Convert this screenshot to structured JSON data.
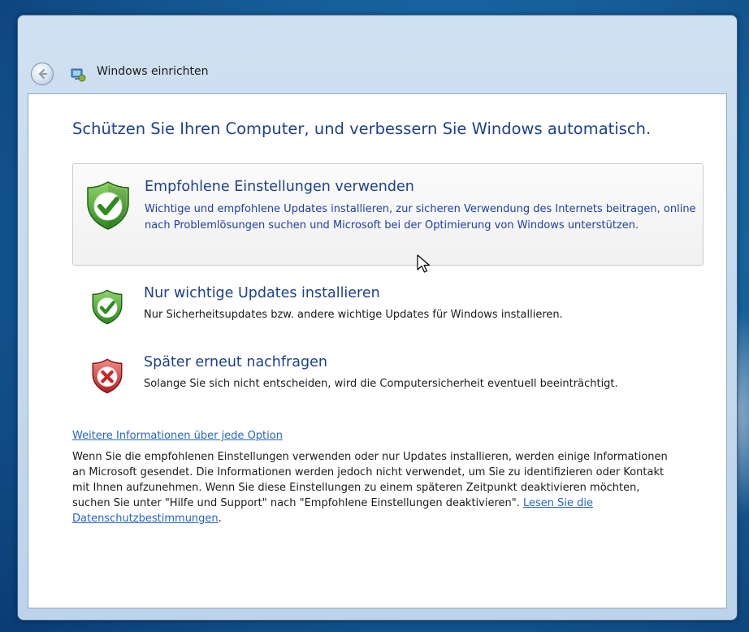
{
  "window": {
    "title": "Windows einrichten"
  },
  "heading": "Schützen Sie Ihren Computer, und verbessern Sie Windows automatisch.",
  "options": [
    {
      "title": "Empfohlene Einstellungen verwenden",
      "description": "Wichtige und empfohlene Updates installieren, zur sicheren Verwendung des Internets beitragen, online nach Problemlösungen suchen und Microsoft bei der Optimierung von Windows unterstützen.",
      "icon": "shield-check-icon",
      "selected": true
    },
    {
      "title": "Nur wichtige Updates installieren",
      "description": "Nur Sicherheitsupdates bzw. andere wichtige Updates für Windows installieren.",
      "icon": "shield-check-icon",
      "selected": false
    },
    {
      "title": "Später erneut nachfragen",
      "description": "Solange Sie sich nicht entscheiden, wird die Computersicherheit eventuell beeinträchtigt.",
      "icon": "shield-x-icon",
      "selected": false
    }
  ],
  "more_info_link": "Weitere Informationen über jede Option",
  "info_text": "Wenn Sie die empfohlenen Einstellungen verwenden oder nur Updates installieren, werden einige Informationen an Microsoft gesendet. Die Informationen werden jedoch nicht verwendet, um Sie zu identifizieren oder Kontakt mit Ihnen aufzunehmen. Wenn Sie diese Einstellungen zu einem späteren Zeitpunkt deaktivieren möchten, suchen Sie unter \"Hilfe und Support\" nach \"Empfohlene Einstellungen deaktivieren\".",
  "privacy_link": "Lesen Sie die Datenschutzbestimmungen",
  "info_text_end": ".",
  "colors": {
    "heading": "#1e3f8f",
    "link": "#2563c8",
    "shield_green": "#3d9a2a",
    "shield_red": "#c8262a",
    "desktop_blue": "#17639f"
  }
}
